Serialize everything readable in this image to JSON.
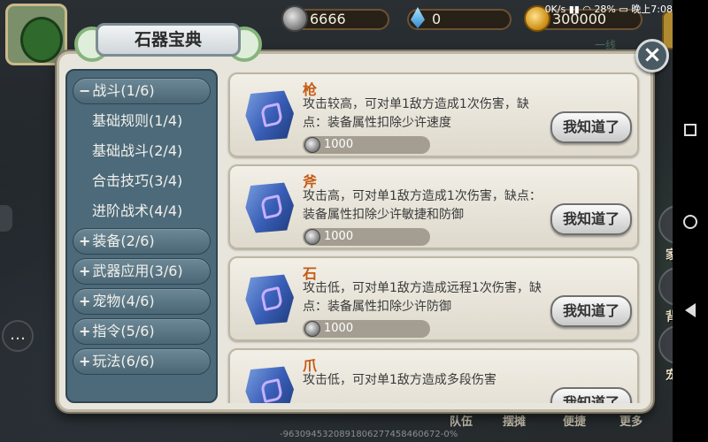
{
  "resources": {
    "coins": "6666",
    "gems": "0",
    "gold": "300000"
  },
  "status_bar": {
    "speed": "0K/s",
    "battery": "28%",
    "time": "晚上7:08"
  },
  "faded_text": "一线",
  "dialog": {
    "title": "石器宝典",
    "close_label": "×"
  },
  "categories": [
    {
      "sign": "−",
      "label": "战斗(1/6)",
      "expanded": true,
      "sub": [
        "基础规则(1/4)",
        "基础战斗(2/4)",
        "合击技巧(3/4)",
        "进阶战术(4/4)"
      ]
    },
    {
      "sign": "+",
      "label": "装备(2/6)"
    },
    {
      "sign": "+",
      "label": "武器应用(3/6)"
    },
    {
      "sign": "+",
      "label": "宠物(4/6)"
    },
    {
      "sign": "+",
      "label": "指令(5/6)"
    },
    {
      "sign": "+",
      "label": "玩法(6/6)"
    }
  ],
  "items": [
    {
      "name": "枪",
      "desc": "攻击较高，可对单1敌方造成1次伤害，缺点：装备属性扣除少许速度",
      "cost": "1000",
      "button": "我知道了"
    },
    {
      "name": "斧",
      "desc": "攻击高，可对单1敌方造成1次伤害，缺点：装备属性扣除少许敏捷和防御",
      "cost": "1000",
      "button": "我知道了"
    },
    {
      "name": "石",
      "desc": "攻击低，可对单1敌方造成远程1次伤害，缺点：装备属性扣除少许防御",
      "cost": "1000",
      "button": "我知道了"
    },
    {
      "name": "爪",
      "desc": "攻击低，可对单1敌方造成多段伤害",
      "cost": "",
      "button": "我知道了"
    }
  ],
  "right_menu": [
    "家族",
    "背包",
    "宠物"
  ],
  "bottom_menu": [
    "队伍",
    "摆摊",
    "便捷",
    "更多"
  ],
  "bottom_id": "-9630945320891806277458460672",
  "bottom_id_suffix": "-0%"
}
